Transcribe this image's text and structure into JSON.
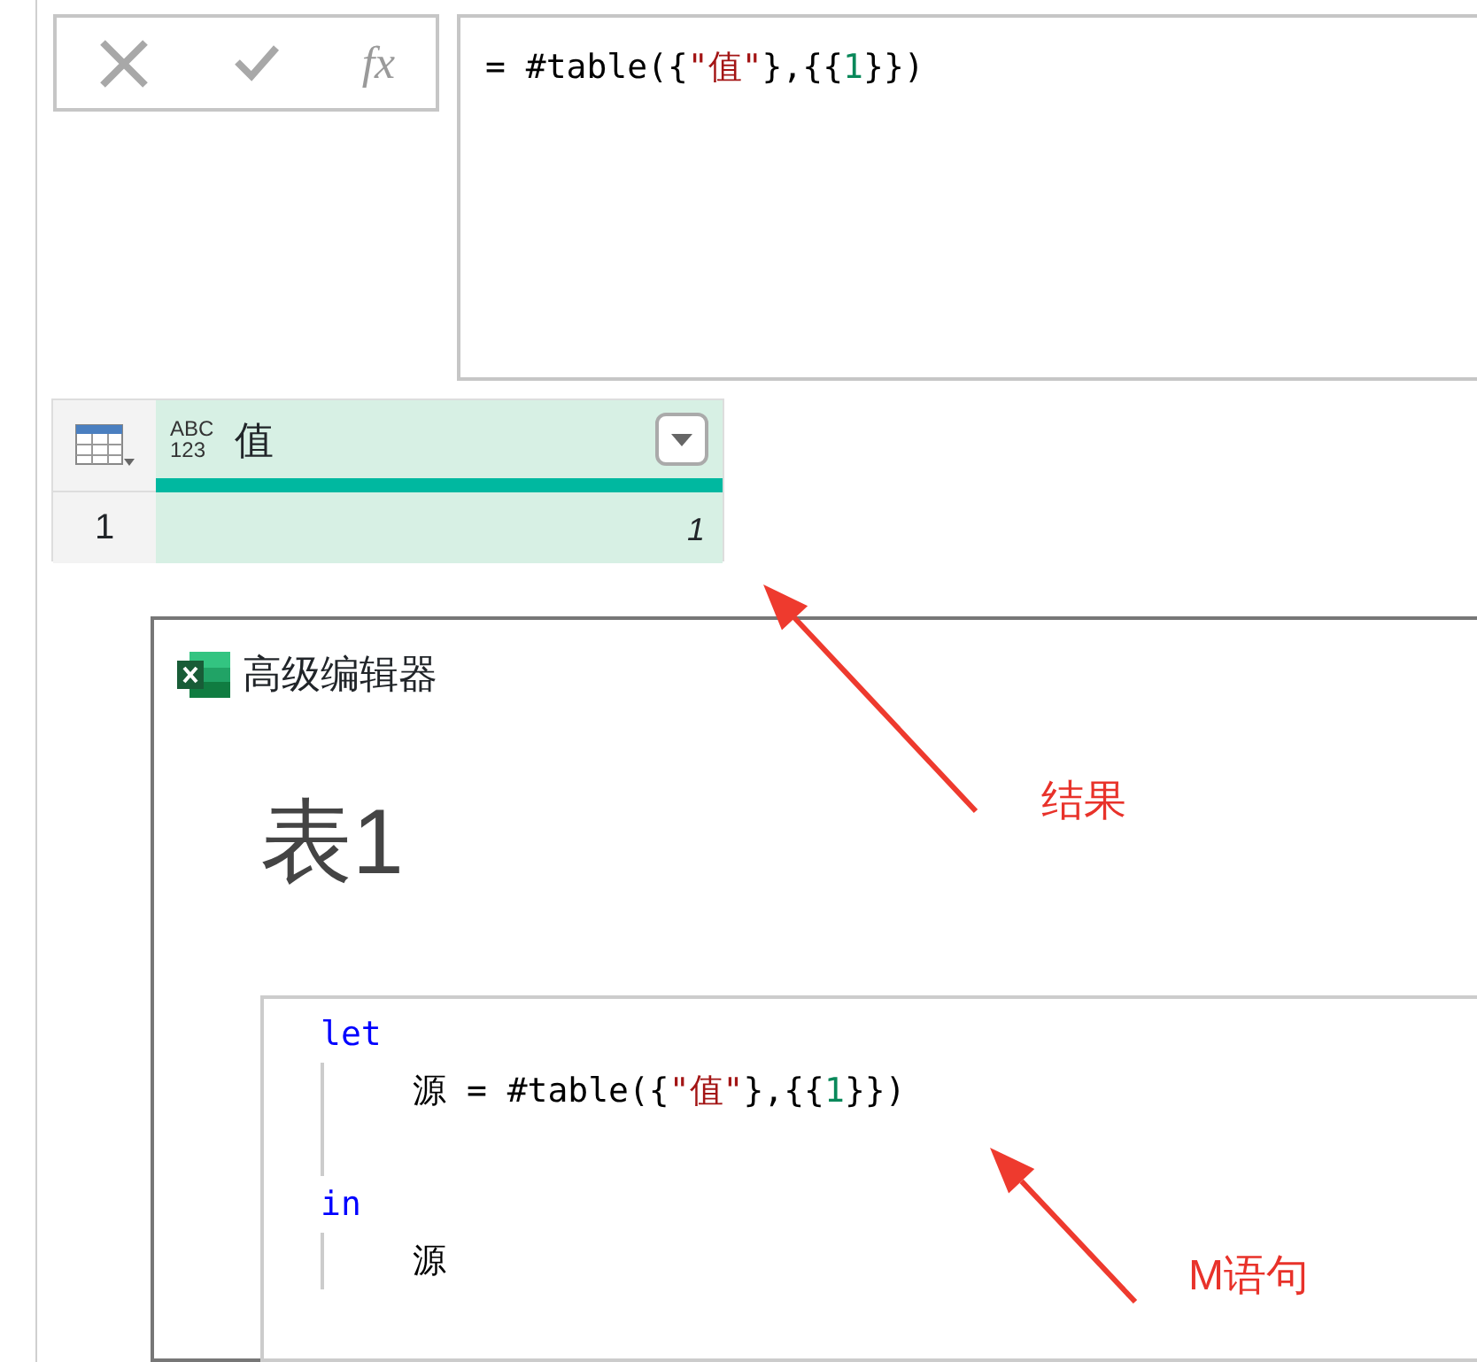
{
  "formula_bar": {
    "fx_label": "fx",
    "formula": [
      {
        "kind": "text",
        "text": "= #table({"
      },
      {
        "kind": "string",
        "text": "\"值\""
      },
      {
        "kind": "text",
        "text": "},{{"
      },
      {
        "kind": "number",
        "text": "1"
      },
      {
        "kind": "text",
        "text": "}})"
      }
    ]
  },
  "table": {
    "type_icon": [
      "ABC",
      "123"
    ],
    "column": "值",
    "rows": [
      {
        "number": "1",
        "value": "1",
        "selected": true
      }
    ]
  },
  "editor": {
    "title": "高级编辑器",
    "query_name": "表1",
    "lines": [
      {
        "kind": "code",
        "tokens": [
          {
            "kind": "keyword",
            "text": "let"
          }
        ],
        "children": [
          {
            "kind": "code",
            "tokens": [
              {
                "kind": "text",
                "text": "源 = #table({"
              },
              {
                "kind": "string",
                "text": "\"值\""
              },
              {
                "kind": "text",
                "text": "},{{"
              },
              {
                "kind": "number",
                "text": "1"
              },
              {
                "kind": "text",
                "text": "}})"
              }
            ]
          },
          {
            "kind": "blank"
          }
        ]
      },
      {
        "kind": "code",
        "tokens": [
          {
            "kind": "keyword",
            "text": "in"
          }
        ],
        "children": [
          {
            "kind": "code",
            "tokens": [
              {
                "kind": "text",
                "text": "源"
              }
            ]
          }
        ]
      }
    ]
  },
  "annotations": [
    {
      "text": "结果"
    },
    {
      "text": "M语句"
    }
  ]
}
